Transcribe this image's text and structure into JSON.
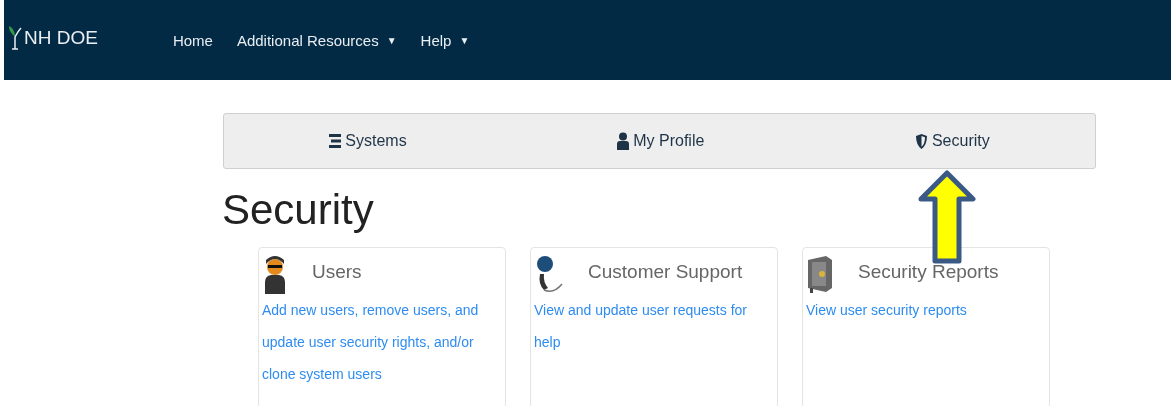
{
  "navbar": {
    "brand": "NH DOE",
    "links": [
      {
        "label": "Home",
        "kind": "link"
      },
      {
        "label": "Additional Resources",
        "kind": "dropdown",
        "caret": "▼"
      },
      {
        "label": "Help",
        "kind": "dropdown",
        "caret": "▼"
      }
    ]
  },
  "tabs": [
    {
      "label": "Systems"
    },
    {
      "label": "My Profile"
    },
    {
      "label": "Security"
    }
  ],
  "heading": "Security",
  "cards": [
    {
      "title": "Users",
      "link": "Add new users, remove users, and update user security rights, and/or clone system users"
    },
    {
      "title": "Customer Support",
      "link": "View and update user requests for help"
    },
    {
      "title": "Security Reports",
      "link": "View user security reports"
    }
  ]
}
